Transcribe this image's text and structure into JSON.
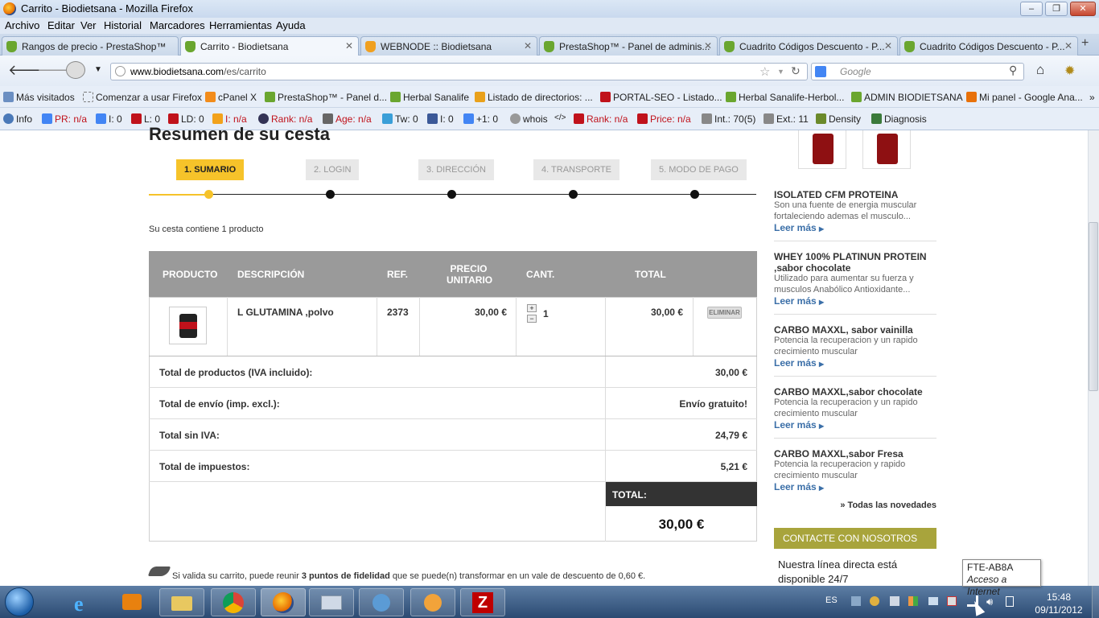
{
  "window": {
    "title": "Carrito - Biodietsana - Mozilla Firefox"
  },
  "menu": [
    "Archivo",
    "Editar",
    "Ver",
    "Historial",
    "Marcadores",
    "Herramientas",
    "Ayuda"
  ],
  "tabs": [
    {
      "label": "Rangos de precio - PrestaShop™"
    },
    {
      "label": "Carrito - Biodietsana"
    },
    {
      "label": "WEBNODE :: Biodietsana"
    },
    {
      "label": "PrestaShop™ - Panel de adminis..."
    },
    {
      "label": "Cuadrito Códigos Descuento - P..."
    },
    {
      "label": "Cuadrito Códigos Descuento - P..."
    }
  ],
  "url": {
    "domain": "www.biodietsana.com",
    "path": "/es/carrito"
  },
  "search": {
    "placeholder": "Google"
  },
  "bookmarks": [
    "Más visitados",
    "Comenzar a usar Firefox",
    "cPanel X",
    "PrestaShop™ - Panel d...",
    "Herbal Sanalife",
    "Listado de directorios: ...",
    "PORTAL-SEO - Listado...",
    "Herbal Sanalife-Herbol...",
    "ADMIN BIODIETSANA",
    "Mi panel - Google Ana..."
  ],
  "seo_toolbar": [
    "Info",
    "PR: n/a",
    "I: 0",
    "L: 0",
    "LD: 0",
    "I: n/a",
    "Rank: n/a",
    "Age: n/a",
    "Tw: 0",
    "I: 0",
    "+1: 0",
    "whois",
    "Rank: n/a",
    "Price: n/a",
    "Int.: 70(5)",
    "Ext.: 11",
    "Density",
    "Diagnosis"
  ],
  "page": {
    "heading": "Resumen de su cesta",
    "steps": [
      "1. SUMARIO",
      "2. LOGIN",
      "3. DIRECCIÓN",
      "4. TRANSPORTE",
      "5. MODO DE PAGO"
    ],
    "cart_count": "Su cesta contiene 1 producto",
    "columns": {
      "product": "PRODUCTO",
      "description": "DESCRIPCIÓN",
      "ref": "REF.",
      "unit_price_1": "PRECIO",
      "unit_price_2": "UNITARIO",
      "qty": "CANT.",
      "total": "TOTAL"
    },
    "item": {
      "description": "L GLUTAMINA ,polvo",
      "ref": "2373",
      "unit_price": "30,00 €",
      "qty": "1",
      "total": "30,00 €",
      "delete": "ELIMINAR"
    },
    "summary": [
      {
        "label": "Total de productos (IVA incluido):",
        "value": "30,00 €"
      },
      {
        "label": "Total de envío (imp. excl.):",
        "value": "Envío gratuito!"
      },
      {
        "label": "Total sin IVA:",
        "value": "24,79 €"
      },
      {
        "label": "Total de impuestos:",
        "value": "5,21 €"
      }
    ],
    "total_label": "TOTAL:",
    "total_value": "30,00 €",
    "loyalty_1": "Si valida su carrito, puede reunir ",
    "loyalty_points": "3 puntos de fidelidad",
    "loyalty_2": " que se puede(n) transformar en un vale de descuento de 0,60 €."
  },
  "sidebar": {
    "products": [
      {
        "name": "ISOLATED CFM PROTEINA",
        "desc": "Son una fuente de energia muscular fortaleciendo ademas el musculo...",
        "more": "Leer más"
      },
      {
        "name": "WHEY 100% PLATINUN PROTEIN ,sabor chocolate",
        "desc": "Utilizado para aumentar su fuerza y musculos Anabólico Antioxidante...",
        "more": "Leer más"
      },
      {
        "name": "CARBO MAXXL, sabor vainilla",
        "desc": "Potencia la recuperacion y un rapido crecimiento muscular",
        "more": "Leer más"
      },
      {
        "name": "CARBO MAXXL,sabor chocolate",
        "desc": "Potencia la recuperacion y un rapido crecimiento muscular",
        "more": "Leer más"
      },
      {
        "name": "CARBO MAXXL,sabor Fresa",
        "desc": "Potencia la recuperacion y rapido crecimiento muscular",
        "more": "Leer más"
      }
    ],
    "all_new": "» Todas las novedades",
    "contact_title": "CONTACTE CON NOSOTROS",
    "contact_text": "Nuestra línea directa está disponible 24/7"
  },
  "taskbar": {
    "lang": "ES",
    "time": "15:48",
    "date": "09/11/2012"
  },
  "tooltip": {
    "line1": "FTE-AB8A",
    "line2": "Acceso a Internet"
  },
  "colors": {
    "accent": "#f6c32a",
    "link": "#3b6fa8",
    "sidebar_header": "#a8a43c"
  }
}
